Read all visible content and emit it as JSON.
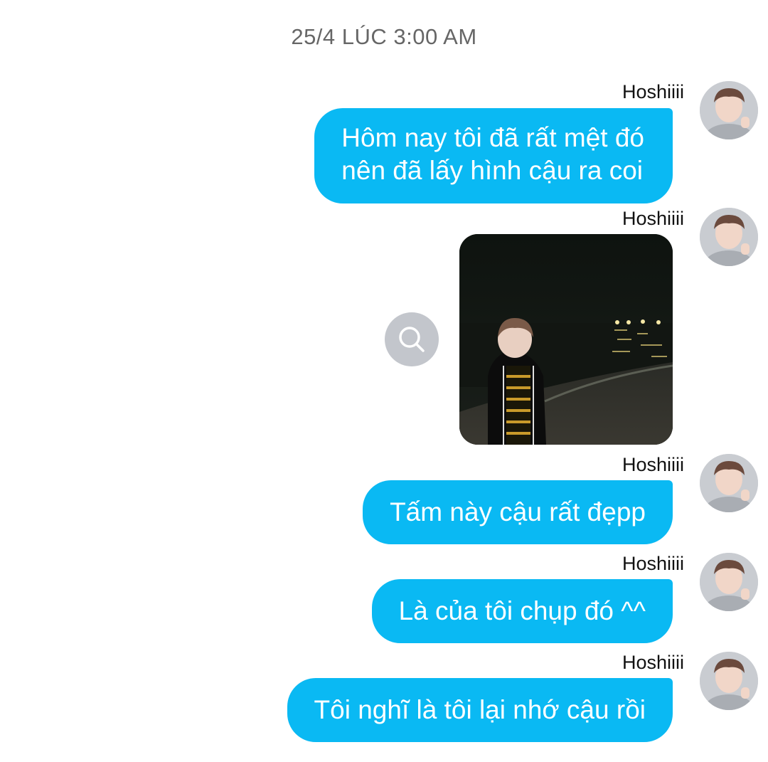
{
  "conversation": {
    "timestamp": "25/4 LÚC 3:00 AM",
    "messages": [
      {
        "sender": "Hoshiiii",
        "type": "text",
        "lines": [
          "Hôm nay tôi đã rất mệt đó",
          "nên đã lấy hình cậu ra coi"
        ]
      },
      {
        "sender": "Hoshiiii",
        "type": "image",
        "image": "night-beach-photo",
        "action_icon": "search-icon"
      },
      {
        "sender": "Hoshiiii",
        "type": "text",
        "text": "Tấm này cậu rất đẹpp"
      },
      {
        "sender": "Hoshiiii",
        "type": "text",
        "text": "Là của tôi chụp đó ^^"
      },
      {
        "sender": "Hoshiiii",
        "type": "text",
        "text": "Tôi nghĩ là tôi lại nhớ cậu rồi"
      }
    ]
  },
  "colors": {
    "bubble": "#0ab9f3",
    "bubble_text": "#ffffff",
    "timestamp": "#666666",
    "zoom_button": "#c3c6cc"
  }
}
